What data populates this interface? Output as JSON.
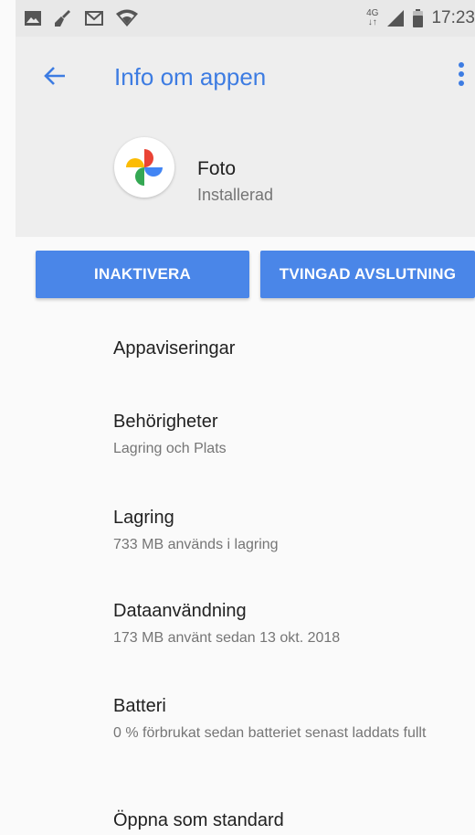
{
  "status_bar": {
    "network_type": "4G",
    "time": "17:23",
    "icons": [
      "image-icon",
      "broom-icon",
      "mail-icon",
      "wifi-icon",
      "signal-icon",
      "battery-icon"
    ]
  },
  "app_bar": {
    "title": "Info om appen",
    "back_icon": "arrow-left-icon",
    "menu_icon": "more-vert-icon",
    "accent_color": "#3d7ce2"
  },
  "app": {
    "name": "Foto",
    "status": "Installerad",
    "icon": "pinwheel-icon"
  },
  "buttons": {
    "disable": "INAKTIVERA",
    "force_stop": "TVINGAD AVSLUTNING",
    "color": "#4a86e8"
  },
  "settings": [
    {
      "title": "Appaviseringar"
    },
    {
      "title": "Behörigheter",
      "summary": "Lagring och Plats"
    },
    {
      "title": "Lagring",
      "summary": "733 MB används i lagring"
    },
    {
      "title": "Dataanvändning",
      "summary": "173 MB använt sedan 13 okt. 2018"
    },
    {
      "title": "Batteri",
      "summary": "0 % förbrukat sedan batteriet senast laddats fullt"
    },
    {
      "title": "Öppna som standard"
    }
  ]
}
